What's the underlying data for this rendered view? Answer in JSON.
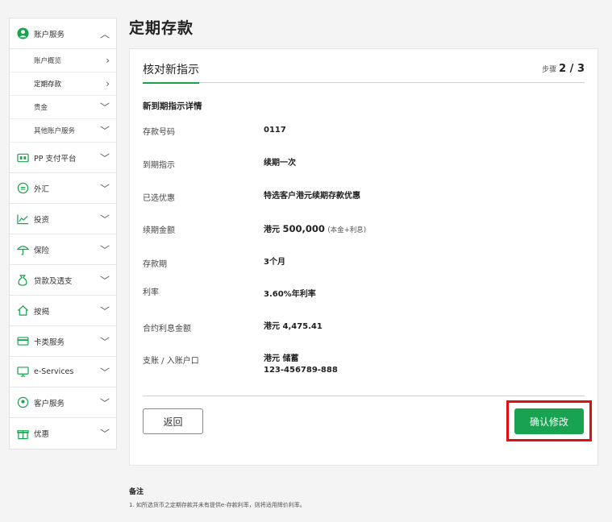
{
  "colors": {
    "accent": "#17a34f",
    "highlight_frame": "#e01010",
    "background": "#f4f4f4"
  },
  "sidebar": {
    "account_services": {
      "label": "账户服务",
      "icon": "user-circle-icon"
    },
    "sub_items": [
      {
        "label": "账户概览"
      },
      {
        "label": "定期存款"
      },
      {
        "label": "贵金"
      },
      {
        "label": "其他账户服务"
      }
    ],
    "items": [
      {
        "label": "PP 支付平台",
        "icon": "payment-icon"
      },
      {
        "label": "外汇",
        "icon": "fx-icon"
      },
      {
        "label": "投资",
        "icon": "chart-icon"
      },
      {
        "label": "保险",
        "icon": "umbrella-icon"
      },
      {
        "label": "贷款及透支",
        "icon": "loan-icon"
      },
      {
        "label": "按揭",
        "icon": "house-icon"
      },
      {
        "label": "卡类服务",
        "icon": "card-icon"
      },
      {
        "label": "e-Services",
        "icon": "eservices-icon"
      },
      {
        "label": "客户服务",
        "icon": "service-icon"
      },
      {
        "label": "优惠",
        "icon": "gift-icon"
      }
    ]
  },
  "page": {
    "title": "定期存款"
  },
  "card": {
    "heading": "核对新指示",
    "step_label": "步骤",
    "step_value": "2 / 3",
    "section_title": "新到期指示详情",
    "details": [
      {
        "label": "存款号码",
        "value": "0117"
      },
      {
        "label": "到期指示",
        "value": "续期一次"
      },
      {
        "label": "已选优惠",
        "value": "特选客户港元续期存款优惠"
      },
      {
        "label": "续期金额",
        "currency": "港元",
        "amount": "500,000",
        "note": "(本金+利息)"
      },
      {
        "label": "存款期",
        "value": "3个月"
      },
      {
        "label": "利率",
        "value": "3.60%年利率"
      },
      {
        "label": "合约利息金额",
        "value": "港元  4,475.41"
      },
      {
        "label": "支账 / 入账户口",
        "value": "港元 储蓄",
        "value2": "123-456789-888"
      }
    ],
    "back_label": "返回",
    "confirm_label": "确认修改"
  },
  "notes": {
    "title": "备注",
    "items": [
      "1.   如所选货币之定期存款并未有提供e-存款利率，则将适用牌价利率。"
    ]
  }
}
